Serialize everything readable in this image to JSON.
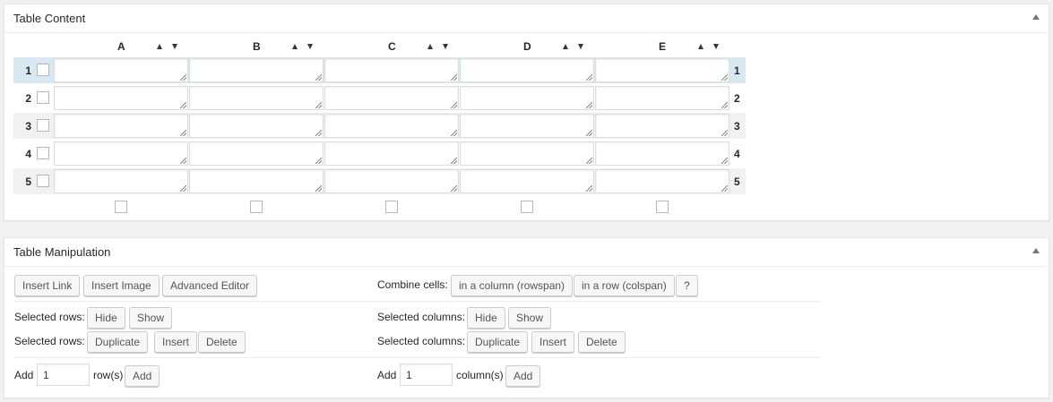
{
  "content_box": {
    "title": "Table Content",
    "columns": [
      "A",
      "B",
      "C",
      "D",
      "E"
    ],
    "rows": [
      "1",
      "2",
      "3",
      "4",
      "5"
    ],
    "cells": [
      [
        "",
        "",
        "",
        "",
        ""
      ],
      [
        "",
        "",
        "",
        "",
        ""
      ],
      [
        "",
        "",
        "",
        "",
        ""
      ],
      [
        "",
        "",
        "",
        "",
        ""
      ],
      [
        "",
        "",
        "",
        "",
        ""
      ]
    ]
  },
  "manip_box": {
    "title": "Table Manipulation",
    "insert_link": "Insert Link",
    "insert_image": "Insert Image",
    "advanced_editor": "Advanced Editor",
    "combine_label": "Combine cells:",
    "rowspan": "in a column (rowspan)",
    "colspan": "in a row (colspan)",
    "help": "?",
    "selected_rows_label": "Selected rows:",
    "selected_columns_label": "Selected columns:",
    "hide": "Hide",
    "show": "Show",
    "duplicate": "Duplicate",
    "insert": "Insert",
    "delete": "Delete",
    "add_label": "Add",
    "add_rows_value": "1",
    "rows_suffix": "row(s)",
    "add_cols_value": "1",
    "cols_suffix": "column(s)",
    "add_button": "Add"
  },
  "colors": {
    "highlight_row": "#d9e8f0",
    "panel_bg": "#ffffff",
    "page_bg": "#f1f1f1"
  }
}
